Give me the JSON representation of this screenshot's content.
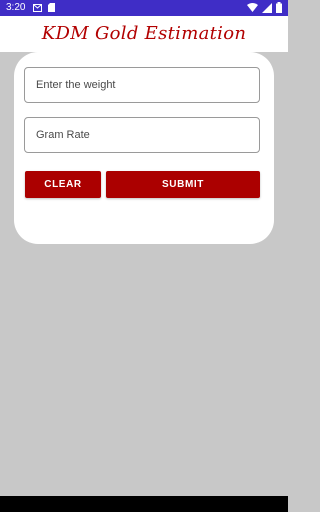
{
  "status_bar": {
    "time": "3:20",
    "left_icons": [
      "gmail-icon",
      "sd-card-icon"
    ],
    "right_icons": [
      "wifi-icon",
      "signal-icon",
      "battery-icon"
    ],
    "background": "#3f2dc6"
  },
  "app_bar": {
    "title": "KDM Gold Estimation",
    "title_color": "#b20000"
  },
  "form": {
    "weight_placeholder": "Enter the weight",
    "weight_value": "",
    "rate_placeholder": "Gram Rate",
    "rate_value": "",
    "clear_label": "CLEAR",
    "submit_label": "SUBMIT",
    "button_color": "#ab0000"
  },
  "page": {
    "background": "#c8c8c8",
    "card_background": "#ffffff"
  }
}
